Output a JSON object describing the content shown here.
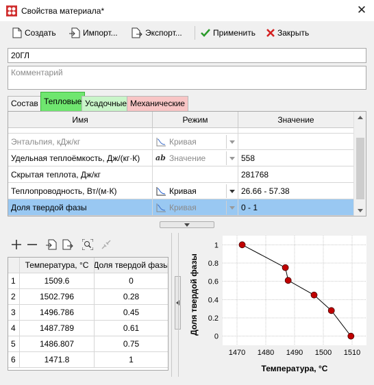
{
  "window": {
    "title": "Свойства материала*",
    "close_glyph": "✕"
  },
  "toolbar": {
    "create": "Создать",
    "import": "Импорт...",
    "export": "Экспорт...",
    "apply": "Применить",
    "close": "Закрыть"
  },
  "material": {
    "name": "20ГЛ",
    "comment_placeholder": "Комментарий"
  },
  "tabs": [
    {
      "label": "Состав"
    },
    {
      "label": "Тепловые"
    },
    {
      "label": "Усадочные"
    },
    {
      "label": "Механические"
    }
  ],
  "grid": {
    "headers": [
      "Имя",
      "Режим",
      "Значение"
    ],
    "rows": [
      {
        "name": "Энтальпия, кДж/кг",
        "mode": "Кривая",
        "value": ""
      },
      {
        "name": "Удельная теплоёмкость, Дж/(кг·К)",
        "mode": "Значение",
        "value": "558"
      },
      {
        "name": "Скрытая теплота, Дж/кг",
        "mode": "",
        "value": "281768"
      },
      {
        "name": "Теплопроводность, Вт/(м·К)",
        "mode": "Кривая",
        "value": "26.66 - 57.38"
      },
      {
        "name": "Доля твердой фазы",
        "mode": "Кривая",
        "value": "0 - 1"
      }
    ]
  },
  "table": {
    "headers": [
      "Температура, °С",
      "Доля твердой фазы"
    ],
    "rows": [
      {
        "i": "1",
        "t": "1509.6",
        "s": "0"
      },
      {
        "i": "2",
        "t": "1502.796",
        "s": "0.28"
      },
      {
        "i": "3",
        "t": "1496.786",
        "s": "0.45"
      },
      {
        "i": "4",
        "t": "1487.789",
        "s": "0.61"
      },
      {
        "i": "5",
        "t": "1486.807",
        "s": "0.75"
      },
      {
        "i": "6",
        "t": "1471.8",
        "s": "1"
      }
    ]
  },
  "chart_data": {
    "type": "line",
    "x": [
      1471.8,
      1486.807,
      1487.789,
      1496.786,
      1502.796,
      1509.6
    ],
    "y": [
      1,
      0.75,
      0.61,
      0.45,
      0.28,
      0
    ],
    "xlabel": "Температура, °С",
    "ylabel": "Доля твердой фазы",
    "xlim": [
      1465,
      1515
    ],
    "ylim": [
      -0.1,
      1.1
    ],
    "xticks": [
      "1470",
      "1480",
      "1490",
      "1500",
      "1510"
    ],
    "yticks": [
      "0",
      "0.2",
      "0.4",
      "0.6",
      "0.8",
      "1"
    ],
    "grid": true,
    "marker_color": "#c00000"
  },
  "colors": {
    "active_tab": "#6fe66f",
    "selected_row": "#99c8f2",
    "apply_check": "#2a9a2a",
    "close_x": "#d42020"
  }
}
